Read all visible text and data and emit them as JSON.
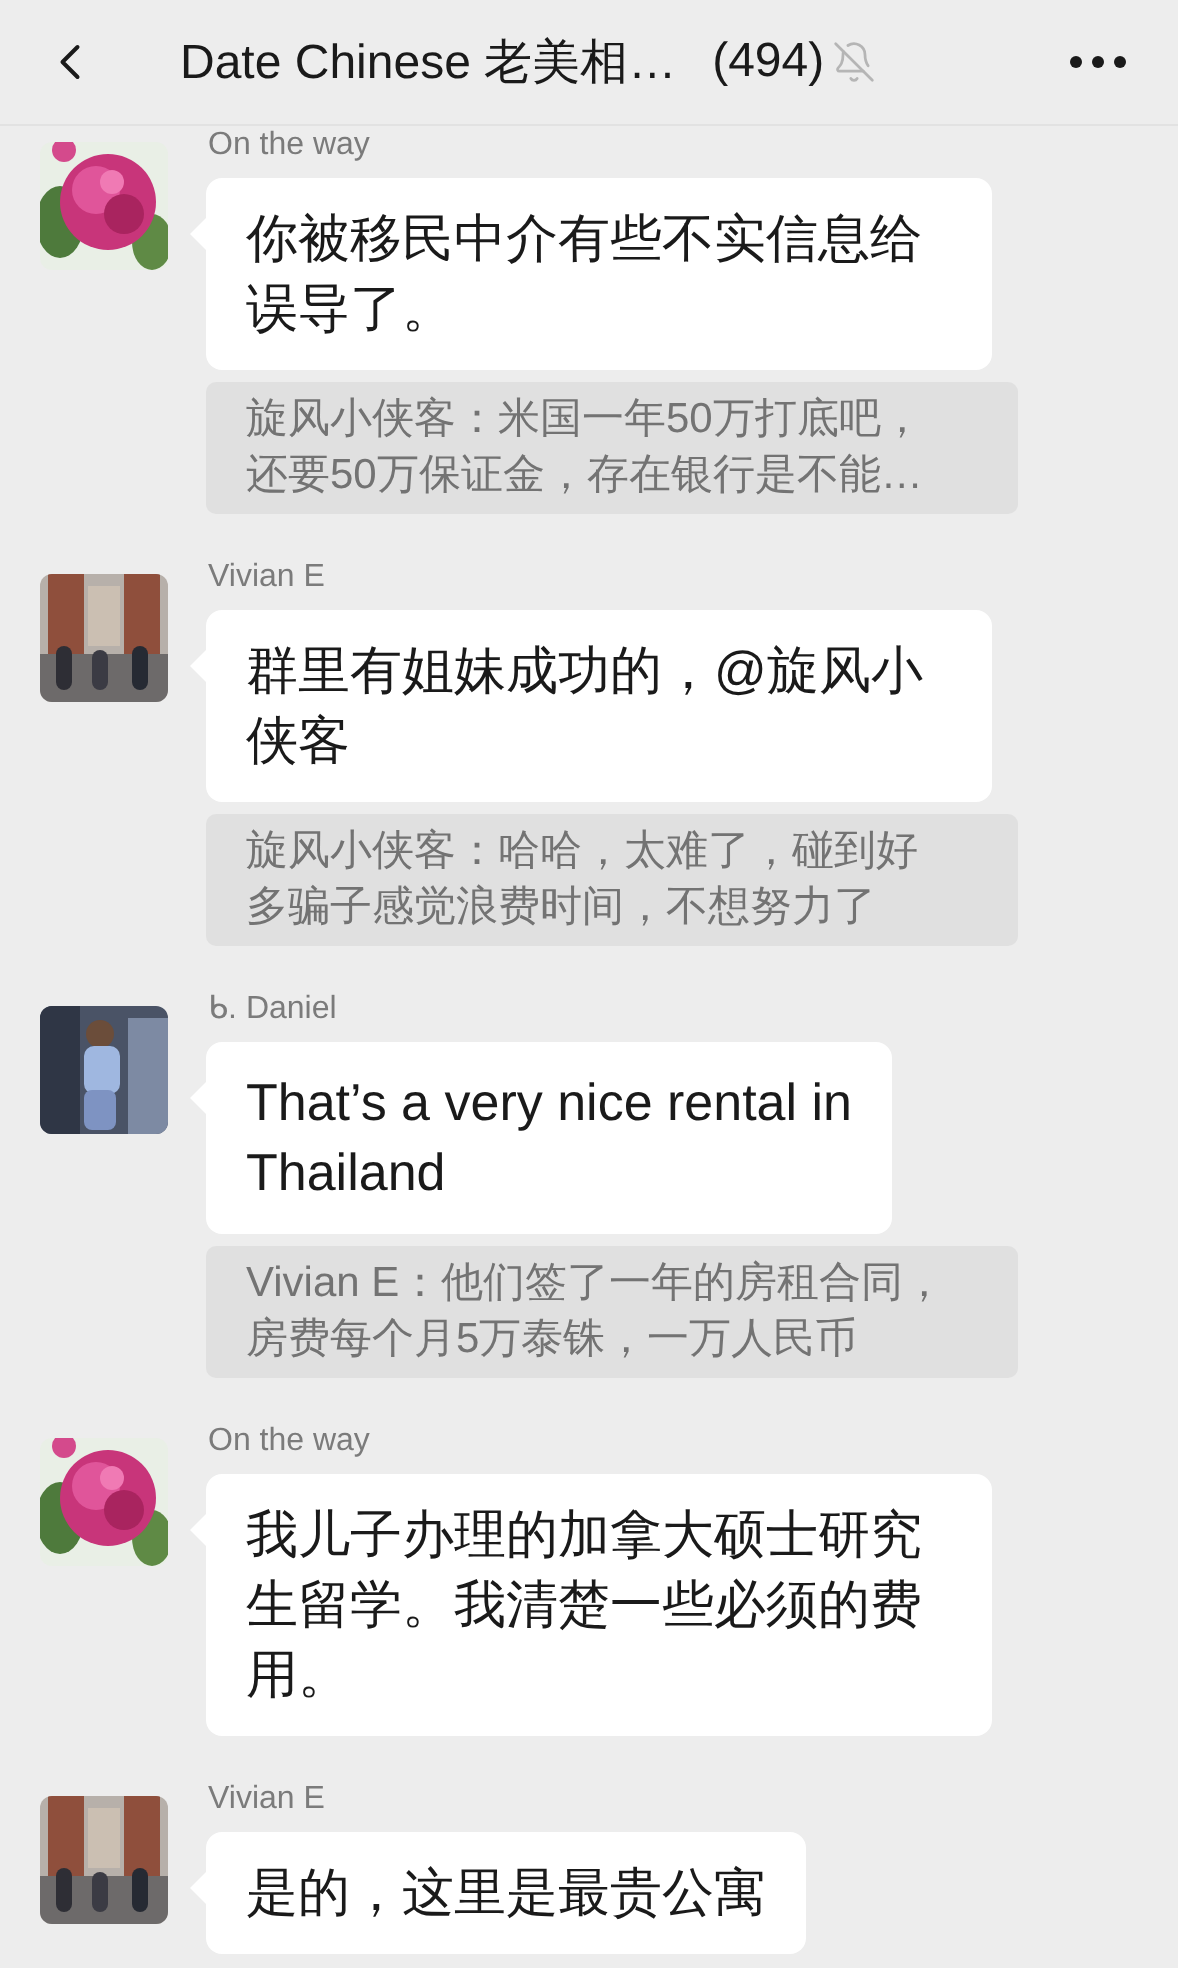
{
  "header": {
    "title": "Date Chinese 老美相…",
    "count": "(494)",
    "muted": true
  },
  "messages": [
    {
      "sender": "On the way",
      "text": "你被移民中介有些不实信息给误导了。",
      "quote": "旋风小侠客：米国一年50万打底吧，还要50万保证金，存在银行是不能…"
    },
    {
      "sender": "Vivian E",
      "text": "群里有姐妹成功的，@旋风小侠客",
      "quote": "旋风小侠客：哈哈，太难了，碰到好多骗子感觉浪费时间，不想努力了"
    },
    {
      "sender": "ᑲ. Daniel",
      "text": "That’s a very nice rental in\nThailand",
      "quote": "Vivian E：他们签了一年的房租合同，房费每个月5万泰铢，一万人民币"
    },
    {
      "sender": "On the way",
      "text": "我儿子办理的加拿大硕士研究生留学。我清楚一些必须的费用。"
    },
    {
      "sender": "Vivian E",
      "text": "是的，这里是最贵公寓"
    }
  ]
}
